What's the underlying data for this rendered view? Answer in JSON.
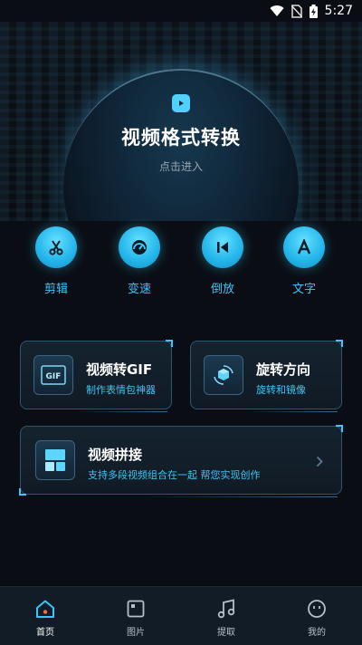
{
  "status_bar": {
    "time": "5:27"
  },
  "hero": {
    "title": "视频格式转换",
    "subtitle": "点击进入"
  },
  "tools": [
    {
      "label": "剪辑",
      "icon": "scissors-icon"
    },
    {
      "label": "变速",
      "icon": "speedometer-icon"
    },
    {
      "label": "倒放",
      "icon": "skip-back-icon"
    },
    {
      "label": "文字",
      "icon": "text-a-icon"
    }
  ],
  "cards": {
    "gif": {
      "title": "视频转GIF",
      "subtitle": "制作表情包神器",
      "icon_text": "GIF"
    },
    "rotate": {
      "title": "旋转方向",
      "subtitle": "旋转和镜像"
    },
    "merge": {
      "title": "视频拼接",
      "subtitle": "支持多段视频组合在一起 帮您实现创作"
    }
  },
  "bottom_nav": [
    {
      "label": "首页",
      "icon": "home-icon",
      "active": true
    },
    {
      "label": "图片",
      "icon": "image-icon",
      "active": false
    },
    {
      "label": "提取",
      "icon": "music-icon",
      "active": false
    },
    {
      "label": "我的",
      "icon": "profile-icon",
      "active": false
    }
  ],
  "colors": {
    "accent": "#39c6f4",
    "background": "#0a0e14",
    "card_border": "#2d5670"
  }
}
